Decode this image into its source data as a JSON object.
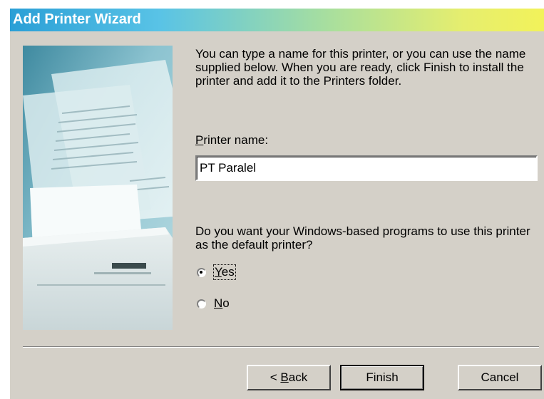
{
  "window": {
    "title": "Add Printer Wizard"
  },
  "illustration": {
    "icon": "printer-with-document-illustration"
  },
  "content": {
    "intro": "You can type a name for this printer, or you can use the name supplied below. When you are ready, click Finish to install the printer and add it to the Printers folder.",
    "printer_name_label_accel": "P",
    "printer_name_label_rest": "rinter name:",
    "printer_name_value": "PT Paralel",
    "default_question": "Do you want your Windows-based programs to use this printer as the default printer?",
    "radio_options": [
      {
        "accel": "Y",
        "rest": "es",
        "selected": true
      },
      {
        "accel": "N",
        "rest": "o",
        "selected": false
      }
    ]
  },
  "buttons": {
    "back_prefix": "< ",
    "back_accel": "B",
    "back_rest": "ack",
    "finish": "Finish",
    "cancel": "Cancel"
  },
  "colors": {
    "dialog_face": "#d4d0c8",
    "title_gradient_start": "#2a9fd6",
    "title_gradient_end": "#f2f25a",
    "title_text": "#ffffff"
  }
}
